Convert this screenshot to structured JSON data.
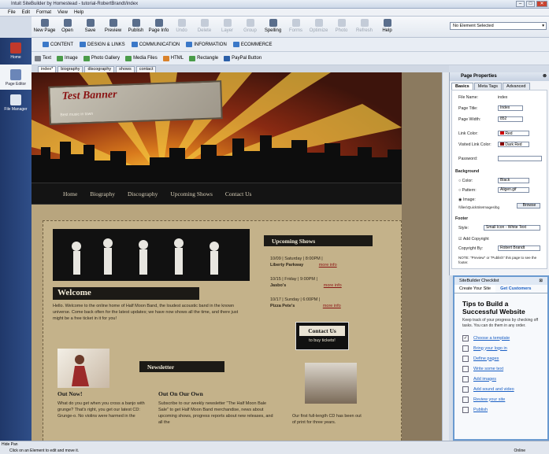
{
  "window": {
    "title": "Intuit SiteBuilder by Homestead - tutorial-RobertBrandt/index"
  },
  "menu": [
    "File",
    "Edit",
    "Format",
    "View",
    "Help"
  ],
  "toolbar": [
    {
      "label": "New Page",
      "enabled": true
    },
    {
      "label": "Open",
      "enabled": true
    },
    {
      "label": "Save",
      "enabled": true
    },
    {
      "label": "Preview",
      "enabled": true
    },
    {
      "label": "Publish",
      "enabled": true
    },
    {
      "label": "Page Info",
      "enabled": true
    },
    {
      "label": "Undo",
      "enabled": false
    },
    {
      "label": "Delete",
      "enabled": false
    },
    {
      "label": "Layer",
      "enabled": false
    },
    {
      "label": "Group",
      "enabled": false
    },
    {
      "label": "Spelling",
      "enabled": true
    },
    {
      "label": "Forms",
      "enabled": false
    },
    {
      "label": "Optimize",
      "enabled": false
    },
    {
      "label": "Photo",
      "enabled": false
    },
    {
      "label": "Refresh",
      "enabled": false
    },
    {
      "label": "Help",
      "enabled": true
    }
  ],
  "element_select": "No Element Selected",
  "leftbar": [
    "Home",
    "Page Editor",
    "File Manager"
  ],
  "insert_primary": [
    "CONTENT",
    "DESIGN & LINKS",
    "COMMUNICATION",
    "INFORMATION",
    "ECOMMERCE"
  ],
  "insert_secondary": [
    "Text",
    "Image",
    "Photo Gallery",
    "Media Files",
    "HTML",
    "Rectangle",
    "PayPal Button"
  ],
  "page_tabs": [
    "index*",
    "biography",
    "discography",
    "shows",
    "contact"
  ],
  "site": {
    "banner_title": "Test Banner",
    "banner_sub": "Best music in town",
    "nav": [
      "Home",
      "Biography",
      "Discography",
      "Upcoming Shows",
      "Contact Us"
    ],
    "welcome_title": "Welcome",
    "welcome_text": "Hello. Welcome to the online home of Half Moon Band, the loudest acoustic band in the known universe. Come back often for the latest updates; we have now shows all the time, and there just might be a free ticket in it for you!",
    "shows_title": "Upcoming Shows",
    "shows": [
      {
        "line1": "10/09 | Saturday | 8:00PM |",
        "line2": "Liberty Parkway",
        "link": "more info"
      },
      {
        "line1": "10/15 | Friday | 9:00PM |",
        "line2": "Jasbo's",
        "link": "more info"
      },
      {
        "line1": "10/17 | Sunday | 6:00PM |",
        "line2": "Pizza Pete's",
        "link": "more info"
      }
    ],
    "contact_title": "Contact Us",
    "contact_sub": "to buy tickets!",
    "newsletter_title": "Newsletter",
    "outnow_title": "Out Now!",
    "outnow_text": "What do you get when you cross a banjo with grunge? That's right, you get our latest CD: Grunge-o. No violins were harmed in the",
    "outonown_title": "Out On Our Own",
    "outonown_text": "Subscribe to our weekly newsletter \"The Half Moon Bale Sale\" to get Half Moon Band merchandise, news about upcoming shows, progress reports about new releases, and all the",
    "firstcd_text": "Our first full-length CD has been out of print for three years."
  },
  "props": {
    "title": "Page Properties",
    "tabs": [
      "Basics",
      "Meta Tags",
      "Advanced"
    ],
    "file_name_label": "File Name:",
    "file_name": "index",
    "page_title_label": "Page Title:",
    "page_title": "Index",
    "page_width_label": "Page Width:",
    "page_width": "852",
    "link_color_label": "Link Color:",
    "link_color": "Red",
    "visited_label": "Visited Link Color:",
    "visited_color": "Dark Red",
    "password_label": "Password:",
    "background_label": "Background",
    "bg_color": "Color:",
    "bg_color_val": "Black",
    "bg_pattern": "Pattern:",
    "bg_pattern_val": "Aligen.gif",
    "bg_image": "Image:",
    "bg_image_path": "\\\\files\\QuickSiteImages\\bg",
    "browse": "Browse",
    "footer_label": "Footer",
    "style_label": "Style:",
    "style_val": "Small Icon - White Text",
    "add_copyright": "Add Copyright",
    "copyright_label": "Copyright By:",
    "copyright_val": "Robert Brandt",
    "note": "NOTE: \"Preview\" or \"Publish\" this page to see the footer."
  },
  "checklist": {
    "title": "SiteBuilder Checklist",
    "tabs": [
      "Create Your Site",
      "Get Customers"
    ],
    "heading": "Tips to Build a Successful Website",
    "desc": "Keep track of your progress by checking off tasks. You can do them in any order.",
    "items": [
      {
        "label": "Choose a template",
        "checked": true
      },
      {
        "label": "Bring your logo in",
        "checked": false
      },
      {
        "label": "Define pages",
        "checked": false
      },
      {
        "label": "Write some text",
        "checked": false
      },
      {
        "label": "Add images",
        "checked": false
      },
      {
        "label": "Add sound and video",
        "checked": false
      },
      {
        "label": "Review your site",
        "checked": false
      },
      {
        "label": "Publish",
        "checked": false
      }
    ]
  },
  "status": {
    "left": "Click on an Element to edit and move it.",
    "right": "Online",
    "hide_pan": "Hide Pan"
  },
  "colors": {
    "accent": "#2f4e88",
    "link": "#1a5fc4",
    "banner_red": "#8a1414"
  }
}
